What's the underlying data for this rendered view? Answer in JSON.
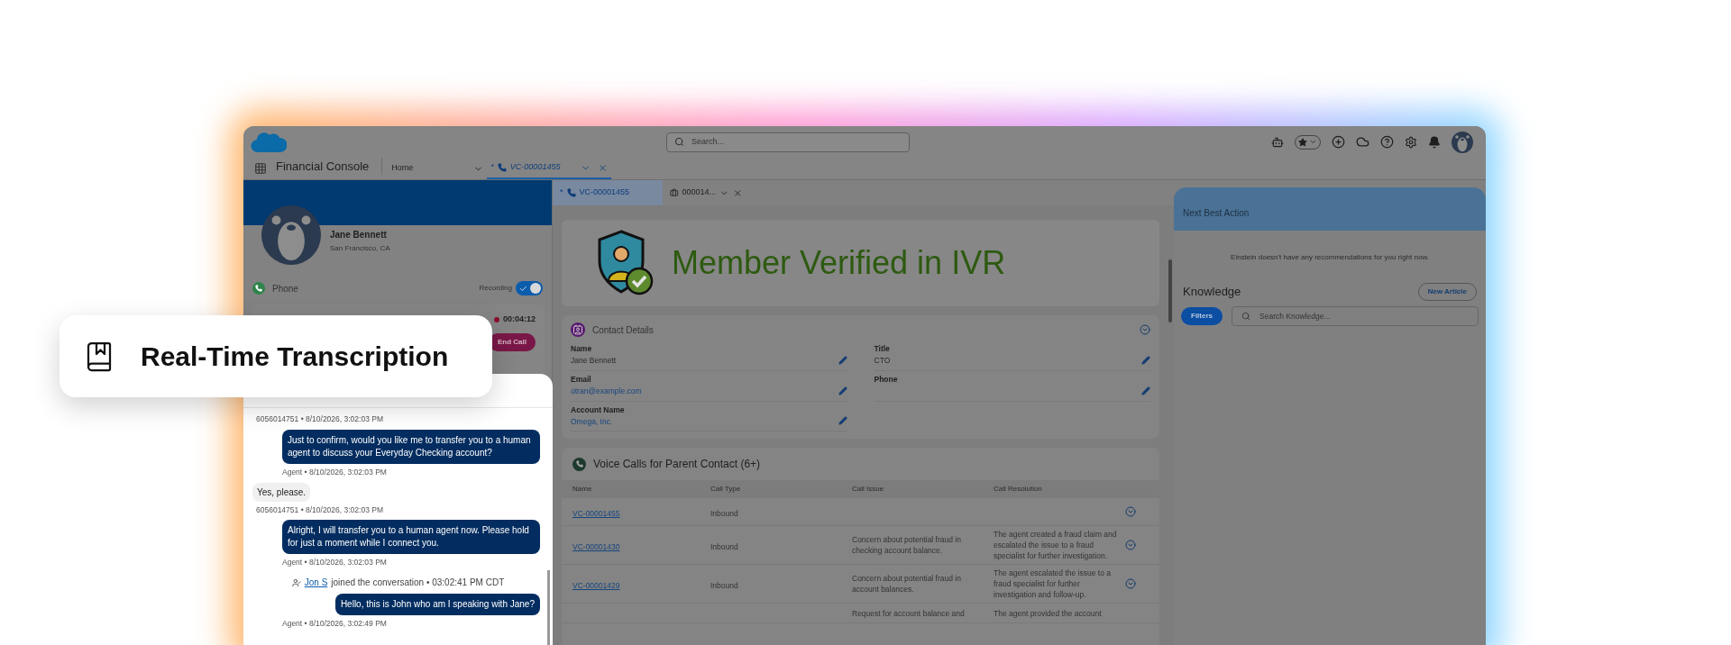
{
  "callout": {
    "title": "Real-Time Transcription"
  },
  "header": {
    "search_placeholder": "Search..."
  },
  "app_name": "Financial Console",
  "nav_tabs": [
    {
      "label": "Home",
      "kind": "home",
      "selected": false
    },
    {
      "label": "VC-00001455",
      "prefix": "*",
      "kind": "call",
      "selected": true
    }
  ],
  "contact": {
    "name": "Jane Bennett",
    "location": "San Francisco, CA"
  },
  "phone": {
    "label": "Phone",
    "recording_label": "Recording",
    "recording": true,
    "timer": "00:04:12",
    "end_call": "End Call"
  },
  "messages": [
    {
      "kind": "meta",
      "text": "6056014751 • 8/10/2026, 3:02:03 PM"
    },
    {
      "kind": "agent",
      "text": "Just to confirm, would you like me to transfer you to a human agent to discuss your Everyday Checking account?",
      "meta": "Agent • 8/10/2026, 3:02:03 PM"
    },
    {
      "kind": "customer",
      "text": "Yes, please.",
      "meta": "6056014751 • 8/10/2026, 3:02:03 PM"
    },
    {
      "kind": "agent",
      "text": "Alright, I will transfer you to a human agent now. Please hold for just a moment while I connect you.",
      "meta": "Agent • 8/10/2026, 3:02:03 PM"
    },
    {
      "kind": "event",
      "user": "Jon S",
      "text": "joined the conversation • 03:02:41 PM CDT"
    },
    {
      "kind": "agent",
      "text": "Hello, this is John who am I speaking with Jane?",
      "meta": "Agent • 8/10/2026, 3:02:49 PM"
    }
  ],
  "subtabs": [
    {
      "label": "VC-00001455",
      "prefix": "*",
      "kind": "call",
      "selected": true
    },
    {
      "label": "000014...",
      "kind": "case",
      "selected": false
    }
  ],
  "banner": {
    "text": "Member Verified in IVR"
  },
  "contact_details": {
    "title": "Contact Details",
    "fields": [
      {
        "label": "Name",
        "value": "Jane Bennett",
        "link": false
      },
      {
        "label": "Title",
        "value": "CTO",
        "link": false
      },
      {
        "label": "Email",
        "value": "otran@example.com",
        "link": true
      },
      {
        "label": "Phone"
      },
      {
        "label": "Account Name",
        "value": "Omega, Inc.",
        "link": true
      }
    ]
  },
  "voice_calls": {
    "title": "Voice Calls for Parent Contact (6+)",
    "columns": [
      "Name",
      "Call Type",
      "Call Issue",
      "Call Resolution"
    ],
    "rows": [
      {
        "name": "VC-00001455",
        "call_type": "Inbound"
      },
      {
        "name": "VC-00001430",
        "call_type": "Inbound",
        "call_issue": "Concern about potential fraud in checking account balance.",
        "call_resolution": "The agent created a fraud claim and escalated the issue to a fraud specialist for further investigation."
      },
      {
        "name": "VC-00001429",
        "call_type": "Inbound",
        "call_issue": "Concern about potential fraud in account balances.",
        "call_resolution": "The agent escalated the issue to a fraud specialist for further investigation and follow-up."
      },
      {
        "call_issue": "Request for account balance and",
        "call_resolution": "The agent provided the account"
      }
    ]
  },
  "next_best_action": {
    "title": "Next Best Action",
    "message": "Einstein doesn't have any recommendations for you right now."
  },
  "knowledge": {
    "title": "Knowledge",
    "new_button": "New Article",
    "filters_button": "Filters",
    "search_placeholder": "Search Knowledge..."
  }
}
